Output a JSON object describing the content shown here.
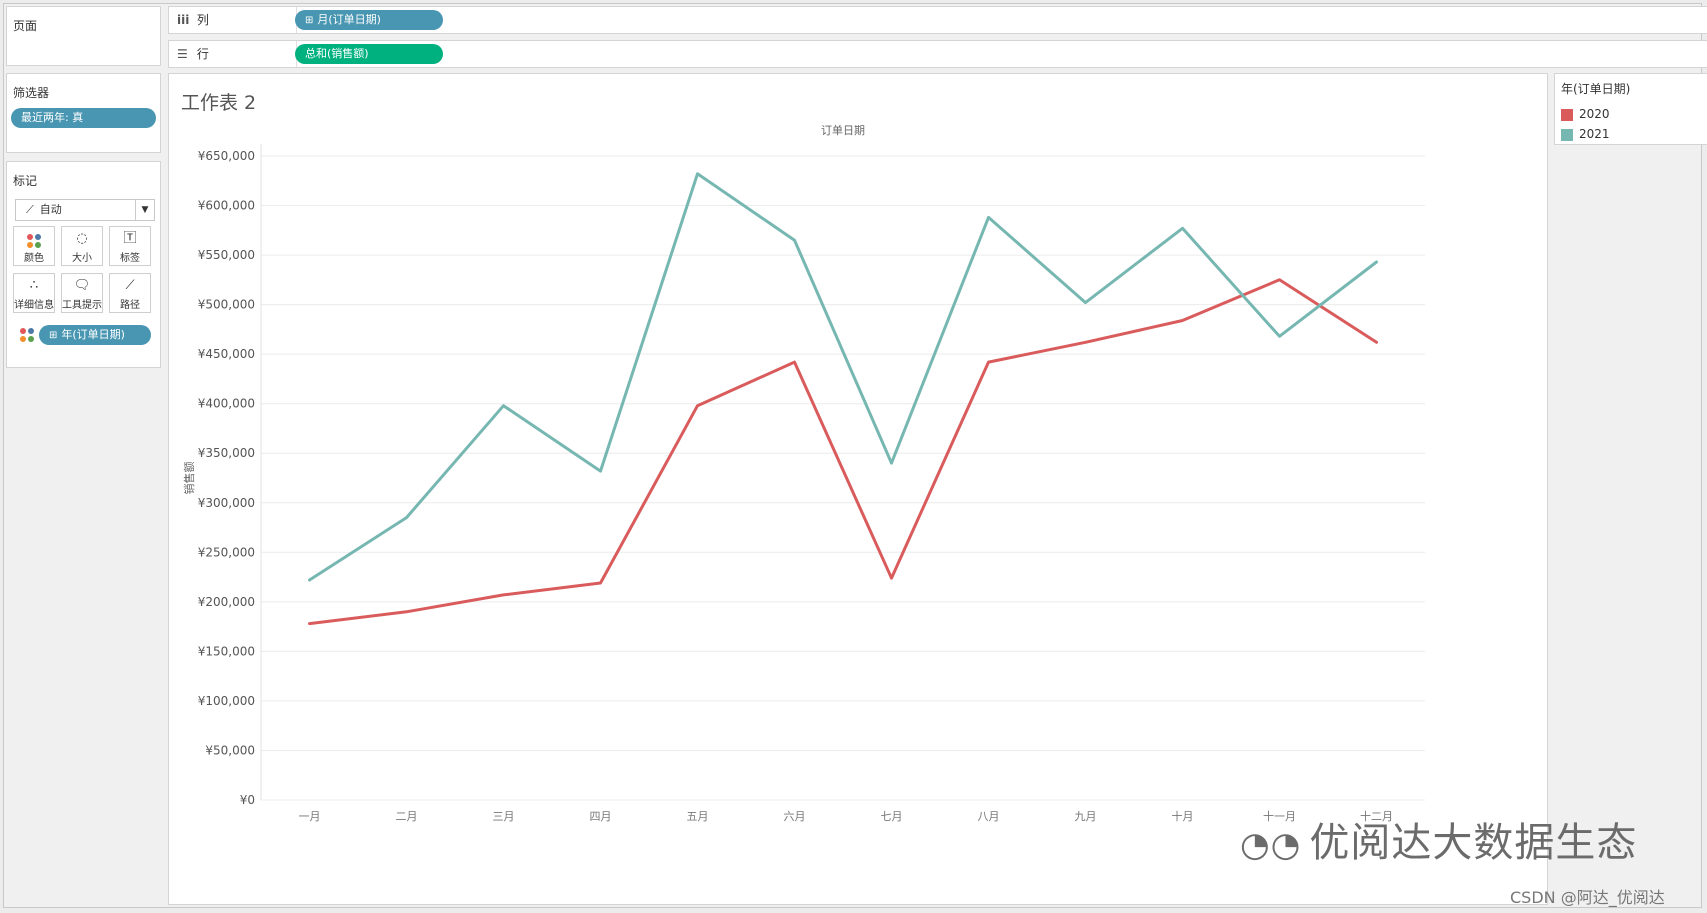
{
  "shelves": {
    "pages_label": "页面",
    "columns_label": "列",
    "columns_pill": "月(订单日期)",
    "rows_label": "行",
    "rows_pill": "总和(销售额)"
  },
  "filters": {
    "title": "筛选器",
    "pill": "最近两年: 真"
  },
  "marks": {
    "title": "标记",
    "type": "自动",
    "buttons": [
      "颜色",
      "大小",
      "标签",
      "详细信息",
      "工具提示",
      "路径"
    ],
    "color_pill": "年(订单日期)"
  },
  "legend": {
    "title": "年(订单日期)",
    "items": [
      {
        "label": "2020",
        "color": "#d95b5c"
      },
      {
        "label": "2021",
        "color": "#76b7b2"
      }
    ]
  },
  "worksheet": {
    "title": "工作表 2"
  },
  "chart_data": {
    "type": "line",
    "title": "订单日期",
    "xlabel": "",
    "ylabel": "销售额",
    "categories": [
      "一月",
      "二月",
      "三月",
      "四月",
      "五月",
      "六月",
      "七月",
      "八月",
      "九月",
      "十月",
      "十一月",
      "十二月"
    ],
    "ylim": [
      0,
      650000
    ],
    "yticks": [
      0,
      50000,
      100000,
      150000,
      200000,
      250000,
      300000,
      350000,
      400000,
      450000,
      500000,
      550000,
      600000,
      650000
    ],
    "ytick_labels": [
      "¥0",
      "¥50,000",
      "¥100,000",
      "¥150,000",
      "¥200,000",
      "¥250,000",
      "¥300,000",
      "¥350,000",
      "¥400,000",
      "¥450,000",
      "¥500,000",
      "¥550,000",
      "¥600,000",
      "¥650,000"
    ],
    "grid": true,
    "series": [
      {
        "name": "2020",
        "color": "#d95b5c",
        "values": [
          178000,
          190000,
          207000,
          219000,
          398000,
          442000,
          224000,
          442000,
          462000,
          484000,
          525000,
          462000
        ]
      },
      {
        "name": "2021",
        "color": "#76b7b2",
        "values": [
          222000,
          285000,
          398000,
          332000,
          632000,
          565000,
          340000,
          588000,
          502000,
          577000,
          468000,
          543000
        ]
      }
    ]
  },
  "watermark": {
    "text": "优阅达大数据生态",
    "credit": "CSDN @阿达_优阅达"
  }
}
